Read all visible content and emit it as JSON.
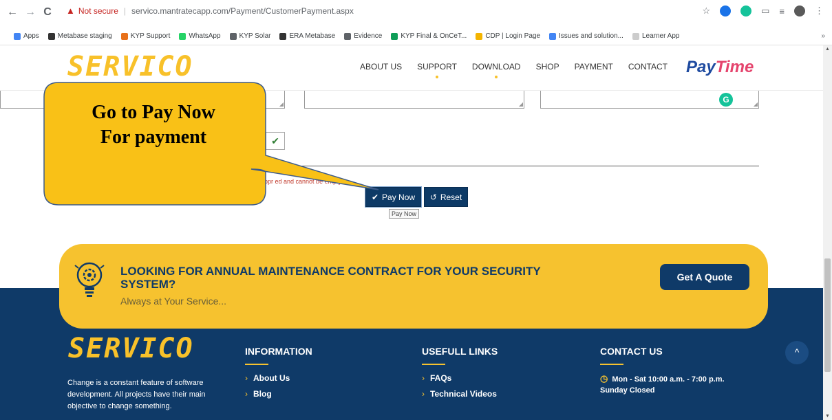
{
  "browser": {
    "back": "←",
    "forward": "→",
    "reload": "C",
    "warning_icon": "▲",
    "not_secure": "Not secure",
    "separator": "|",
    "url": "servico.mantratecapp.com/Payment/CustomerPayment.aspx",
    "bookmarks": [
      {
        "label": "Apps",
        "color": "#4285f4"
      },
      {
        "label": "Metabase staging",
        "color": "#333333"
      },
      {
        "label": "KYP Support",
        "color": "#e8711a"
      },
      {
        "label": "WhatsApp",
        "color": "#25d366"
      },
      {
        "label": "KYP Solar",
        "color": "#5f6368"
      },
      {
        "label": "ERA Metabase",
        "color": "#333333"
      },
      {
        "label": "Evidence",
        "color": "#5f6368"
      },
      {
        "label": "KYP Final & OnCeT...",
        "color": "#0f9d58"
      },
      {
        "label": "CDP | Login Page",
        "color": "#f4b400"
      },
      {
        "label": "Issues and solution...",
        "color": "#4285f4"
      },
      {
        "label": "Learner App",
        "color": "#cccccc"
      }
    ],
    "more_bookmarks": "»"
  },
  "site": {
    "logo": "SERVICO",
    "menu": [
      {
        "label": "ABOUT US",
        "dot": false
      },
      {
        "label": "SUPPORT",
        "dot": true
      },
      {
        "label": "DOWNLOAD",
        "dot": true
      },
      {
        "label": "SHOP",
        "dot": false
      },
      {
        "label": "PAYMENT",
        "dot": false
      },
      {
        "label": "CONTACT",
        "dot": false
      }
    ],
    "paytime_1": "Pay",
    "paytime_2": "Time"
  },
  "form": {
    "grammarly_icon": "G",
    "check_mark": "✔",
    "error_text": "Appr                                    ed and cannot be empty",
    "pay_now_label": "Pay Now",
    "reset_label": "Reset",
    "tooltip": "Pay Now"
  },
  "callout": {
    "line1": "Go to Pay Now",
    "line2": "For payment",
    "fill_color": "#f9c117",
    "border_color": "#3e5c8a"
  },
  "banner": {
    "title_line1": "LOOKING FOR ANNUAL MAINTENANCE CONTRACT FOR YOUR SECURITY",
    "title_line2": "SYSTEM?",
    "subtitle": "Always at Your Service...",
    "button": "Get A Quote"
  },
  "footer": {
    "logo": "SERVICO",
    "about": "Change is a constant feature of software development. All projects have their main objective to change something.",
    "information": {
      "heading": "INFORMATION",
      "links": [
        "About Us",
        "Blog"
      ]
    },
    "useful_links": {
      "heading": "USEFULL LINKS",
      "links": [
        "FAQs",
        "Technical Videos"
      ]
    },
    "contact": {
      "heading": "CONTACT US",
      "hours_line1": "Mon - Sat 10:00 a.m. - 7:00 p.m.",
      "hours_line2": "Sunday Closed"
    },
    "to_top": "^"
  }
}
